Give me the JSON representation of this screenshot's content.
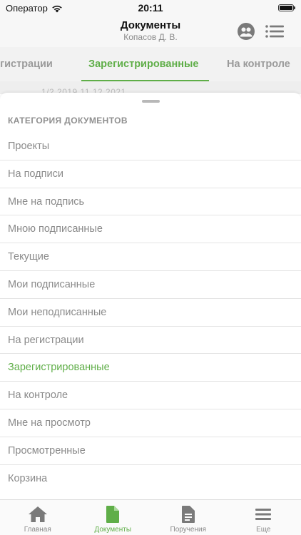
{
  "status_bar": {
    "carrier": "Оператор",
    "time": "20:11",
    "battery_level": 1.0
  },
  "nav": {
    "title": "Документы",
    "subtitle": "Копасов Д. В.",
    "left_icon": "users-icon",
    "right_icon": "list-menu-icon"
  },
  "tabs": [
    {
      "label": "егистрации",
      "active": false
    },
    {
      "label": "Зарегистрированные",
      "active": true
    },
    {
      "label": "На контроле",
      "active": false
    }
  ],
  "under_strip_text": "1/2 2019     11.12.2021",
  "sheet": {
    "header": "КАТЕГОРИЯ ДОКУМЕНТОВ",
    "items": [
      {
        "label": "Проекты",
        "active": false
      },
      {
        "label": "На подписи",
        "active": false
      },
      {
        "label": "Мне на подпись",
        "active": false
      },
      {
        "label": "Мною подписанные",
        "active": false
      },
      {
        "label": "Текущие",
        "active": false
      },
      {
        "label": "Мои подписанные",
        "active": false
      },
      {
        "label": "Мои неподписанные",
        "active": false
      },
      {
        "label": "На регистрации",
        "active": false
      },
      {
        "label": "Зарегистрированные",
        "active": true
      },
      {
        "label": "На контроле",
        "active": false
      },
      {
        "label": "Мне на просмотр",
        "active": false
      },
      {
        "label": "Просмотренные",
        "active": false
      },
      {
        "label": "Корзина",
        "active": false
      }
    ]
  },
  "tab_bar": [
    {
      "label": "Главная",
      "icon": "home-icon",
      "active": false
    },
    {
      "label": "Документы",
      "icon": "document-icon",
      "active": true
    },
    {
      "label": "Поручения",
      "icon": "assignment-icon",
      "active": false
    },
    {
      "label": "Еще",
      "icon": "more-icon",
      "active": false
    }
  ],
  "colors": {
    "accent": "#5fae48",
    "text_muted": "#8a8a8a",
    "icon_grey": "#7a7a7a"
  }
}
